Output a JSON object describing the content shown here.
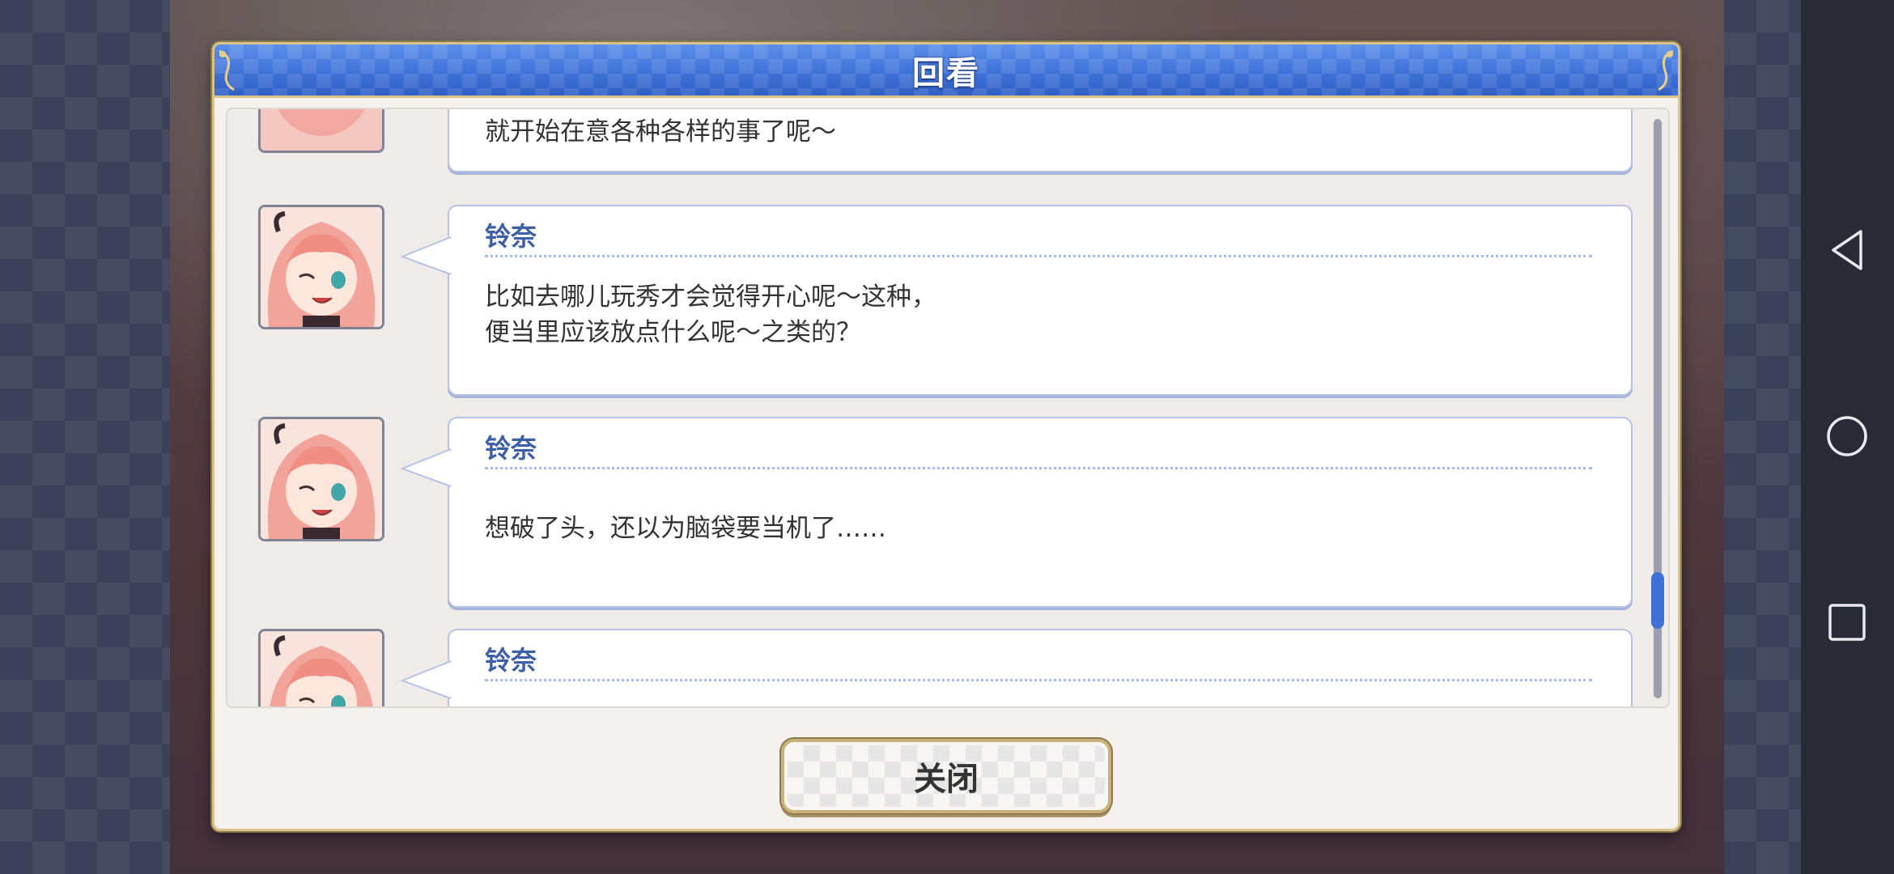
{
  "dialog": {
    "title": "回看",
    "close_label": "关闭"
  },
  "log": [
    {
      "speaker": "",
      "lines": "就开始在意各种各样的事了呢～"
    },
    {
      "speaker": "铃奈",
      "lines": "比如去哪儿玩秀才会觉得开心呢～这种，\n便当里应该放点什么呢～之类的？"
    },
    {
      "speaker": "铃奈",
      "lines": "想破了头，还以为脑袋要当机了……"
    },
    {
      "speaker": "铃奈",
      "lines": ""
    }
  ],
  "icons": {
    "nav_back": "back-triangle-icon",
    "nav_home": "home-circle-icon",
    "nav_recent": "recent-square-icon"
  },
  "colors": {
    "header_blue": "#3f72d8",
    "speaker_blue": "#3c5fa8",
    "frame_gold": "#d8c48a"
  }
}
